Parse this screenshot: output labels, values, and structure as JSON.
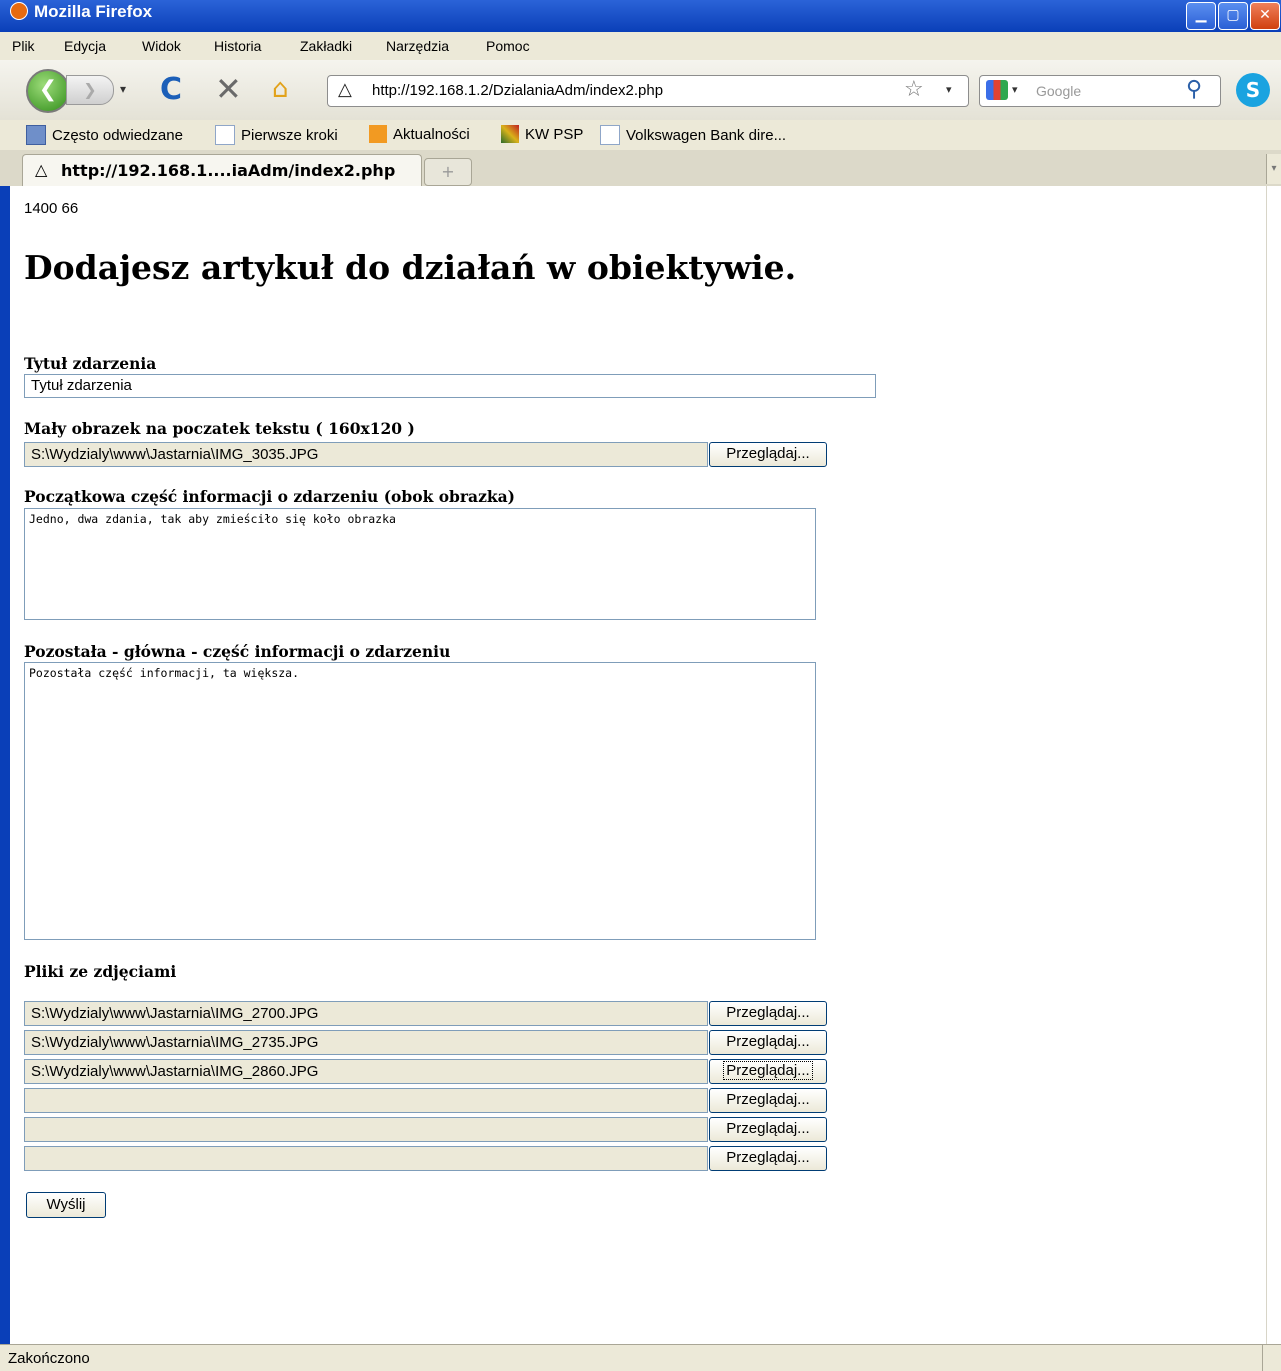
{
  "window": {
    "title": "Mozilla Firefox",
    "minimize_glyph": "▁",
    "maximize_glyph": "▢",
    "close_glyph": "✕"
  },
  "menu": {
    "items": [
      "Plik",
      "Edycja",
      "Widok",
      "Historia",
      "Zakładki",
      "Narzędzia",
      "Pomoc"
    ]
  },
  "navbar": {
    "back_glyph": "❮",
    "forward_glyph": "❯",
    "dropdown_glyph": "▾",
    "reload_glyph": "C",
    "stop_glyph": "✕",
    "home_glyph": "⌂",
    "site_icon_glyph": "△",
    "url": "http://192.168.1.2/DzialaniaAdm/index2.php",
    "star_glyph": "☆",
    "search_placeholder": "Google",
    "search_glyph": "⚲",
    "skype_glyph": "S"
  },
  "bookmarks": [
    {
      "label": "Często odwiedzane",
      "icon": "frequent-icon"
    },
    {
      "label": "Pierwsze kroki",
      "icon": "page-icon"
    },
    {
      "label": "Aktualności",
      "icon": "rss-icon"
    },
    {
      "label": "KW PSP",
      "icon": "kwpsp-icon"
    },
    {
      "label": "Volkswagen Bank dire...",
      "icon": "page-icon"
    }
  ],
  "tab": {
    "icon_glyph": "△",
    "label": "http://192.168.1....iaAdm/index2.php",
    "new_tab_glyph": "+",
    "scroll_glyph": "▾"
  },
  "page": {
    "counter": "1400 66",
    "heading": "Dodajesz artykuł do działań w obiektywie.",
    "title_label": "Tytuł zdarzenia",
    "title_value": "Tytuł zdarzenia",
    "thumb_label": "Mały obrazek na poczatek tekstu ( 160x120 )",
    "thumb_value": "S:\\Wydzialy\\www\\Jastarnia\\IMG_3035.JPG",
    "browse_label": "Przeglądaj...",
    "intro_label": "Początkowa część informacji o zdarzeniu (obok obrazka)",
    "intro_value": "Jedno, dwa zdania, tak aby zmieściło się koło obrazka",
    "main_label": "Pozostała - główna - część informacji o zdarzeniu",
    "main_value": "Pozostała część informacji,  ta większa.",
    "files_label": "Pliki ze zdjęciami",
    "files": [
      "S:\\Wydzialy\\www\\Jastarnia\\IMG_2700.JPG",
      "S:\\Wydzialy\\www\\Jastarnia\\IMG_2735.JPG",
      "S:\\Wydzialy\\www\\Jastarnia\\IMG_2860.JPG",
      "",
      "",
      ""
    ],
    "submit_label": "Wyślij"
  },
  "status": {
    "text": "Zakończono"
  }
}
